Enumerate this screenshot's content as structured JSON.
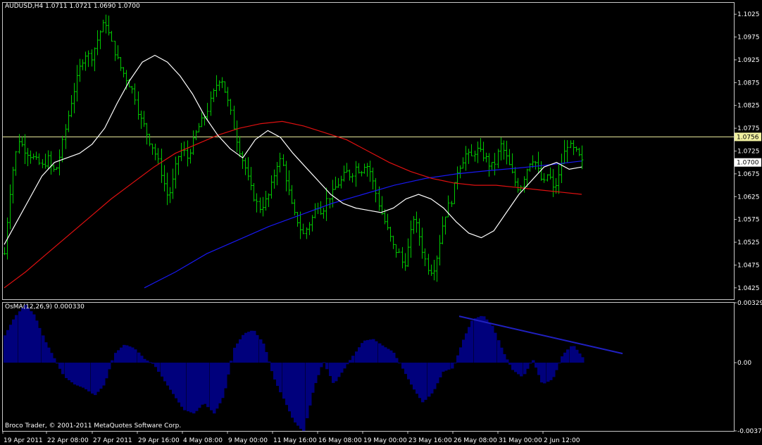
{
  "main_pane": {
    "header": "AUDUSD,H4  1.0711 1.0721 1.0690 1.0700",
    "y_ticks": [
      "1.1025",
      "1.0975",
      "1.0925",
      "1.0875",
      "1.0825",
      "1.0775",
      "1.0725",
      "1.0675",
      "1.0625",
      "1.0575",
      "1.0525",
      "1.0475",
      "1.0425"
    ],
    "hline_label": "1.0756",
    "price_label": "1.0700"
  },
  "osc_pane": {
    "header": "OsMA(12,26,9) 0.000330",
    "y_ticks": [
      "0.003290",
      "0.00",
      "-0.003750"
    ],
    "copyright": "Broco Trader, © 2001-2011 MetaQuotes Software Corp."
  },
  "x_ticks": [
    "19 Apr 2011",
    "22 Apr 08:00",
    "27 Apr 2011",
    "29 Apr 16:00",
    "4 May 08:00",
    "9 May 00:00",
    "11 May 16:00",
    "16 May 08:00",
    "19 May 00:00",
    "23 May 16:00",
    "26 May 08:00",
    "31 May 00:00",
    "2 Jun 12:00"
  ],
  "chart_data": [
    {
      "type": "ohlc",
      "symbol": "AUDUSD",
      "timeframe": "H4",
      "last_bar": {
        "open": 1.0711,
        "high": 1.0721,
        "low": 1.069,
        "close": 1.07
      },
      "ylim": [
        1.04,
        1.105
      ],
      "horizontal_line": 1.0756,
      "current_price": 1.07,
      "colors": {
        "bars": "#00c800",
        "ma_fast": "#ffffff",
        "ma_mid": "#e01010",
        "ma_slow": "#1818f0",
        "hline": "#f0f0a0"
      },
      "close_path": [
        1.05,
        1.062,
        1.07,
        1.075,
        1.073,
        1.072,
        1.071,
        1.07,
        1.069,
        1.071,
        1.068,
        1.069,
        1.074,
        1.079,
        1.084,
        1.088,
        1.092,
        1.094,
        1.093,
        1.096,
        1.099,
        1.101,
        1.097,
        1.094,
        1.091,
        1.089,
        1.087,
        1.085,
        1.08,
        1.078,
        1.075,
        1.073,
        1.07,
        1.066,
        1.062,
        1.066,
        1.071,
        1.073,
        1.071,
        1.074,
        1.077,
        1.079,
        1.081,
        1.084,
        1.087,
        1.089,
        1.085,
        1.081,
        1.076,
        1.072,
        1.069,
        1.065,
        1.062,
        1.06,
        1.061,
        1.063,
        1.067,
        1.071,
        1.069,
        1.064,
        1.059,
        1.057,
        1.054,
        1.056,
        1.058,
        1.061,
        1.059,
        1.062,
        1.063,
        1.065,
        1.066,
        1.068,
        1.067,
        1.069,
        1.068,
        1.07,
        1.068,
        1.064,
        1.06,
        1.057,
        1.054,
        1.051,
        1.05,
        1.047,
        1.052,
        1.058,
        1.055,
        1.05,
        1.047,
        1.046,
        1.05,
        1.056,
        1.06,
        1.062,
        1.068,
        1.07,
        1.072,
        1.071,
        1.073,
        1.072,
        1.071,
        1.069,
        1.07,
        1.074,
        1.072,
        1.069,
        1.066,
        1.064,
        1.067,
        1.07,
        1.071,
        1.068,
        1.065,
        1.068,
        1.064,
        1.066,
        1.071,
        1.074,
        1.073,
        1.072,
        1.07
      ],
      "ma_fast": [
        1.052,
        1.057,
        1.062,
        1.067,
        1.07,
        1.071,
        1.072,
        1.074,
        1.0775,
        1.083,
        1.088,
        1.092,
        1.0935,
        1.092,
        1.089,
        1.085,
        1.08,
        1.076,
        1.073,
        1.071,
        1.075,
        1.077,
        1.0755,
        1.072,
        1.069,
        1.066,
        1.063,
        1.061,
        1.06,
        1.0595,
        1.059,
        1.06,
        1.062,
        1.063,
        1.062,
        1.06,
        1.057,
        1.0545,
        1.0535,
        1.055,
        1.059,
        1.063,
        1.066,
        1.069,
        1.07,
        1.0685,
        1.069
      ],
      "ma_mid": [
        1.0425,
        1.046,
        1.05,
        1.054,
        1.058,
        1.062,
        1.0655,
        1.069,
        1.072,
        1.074,
        1.076,
        1.0775,
        1.0785,
        1.079,
        1.078,
        1.0765,
        1.075,
        1.0725,
        1.07,
        1.068,
        1.0665,
        1.0655,
        1.065,
        1.065,
        1.0645,
        1.064,
        1.0635,
        1.063
      ],
      "ma_slow": [
        1.0425,
        1.046,
        1.05,
        1.053,
        1.056,
        1.0585,
        1.061,
        1.063,
        1.065,
        1.0665,
        1.0675,
        1.0682,
        1.0688,
        1.0695,
        1.0703
      ]
    },
    {
      "type": "histogram",
      "name": "OsMA(12,26,9)",
      "last_value": 0.00033,
      "ylim": [
        -0.00375,
        0.00329
      ],
      "color": "#00007c",
      "trendline": {
        "from": 0.00255,
        "to": 0.0005
      },
      "values": [
        0.0015,
        0.0025,
        0.0032,
        0.0026,
        0.0012,
        0.0002,
        -0.0008,
        -0.0012,
        -0.0014,
        -0.0018,
        -0.0012,
        0.0005,
        0.001,
        0.0008,
        0.0002,
        -0.0001,
        -0.001,
        -0.0018,
        -0.0026,
        -0.0028,
        -0.0022,
        -0.0028,
        -0.0018,
        0.0008,
        0.0016,
        0.0018,
        0.001,
        -0.0008,
        -0.002,
        -0.0032,
        -0.0038,
        -0.0014,
        0.0001,
        -0.0012,
        -0.0004,
        0.0004,
        0.0012,
        0.0013,
        0.0009,
        0.0006,
        -0.0004,
        -0.0014,
        -0.0022,
        -0.0016,
        -0.0005,
        -0.0003,
        0.0012,
        0.0024,
        0.0026,
        0.002,
        0.0006,
        -0.0004,
        -0.0008,
        0.0002,
        -0.0012,
        -0.0009,
        0.0004,
        0.001,
        0.0003
      ]
    }
  ]
}
